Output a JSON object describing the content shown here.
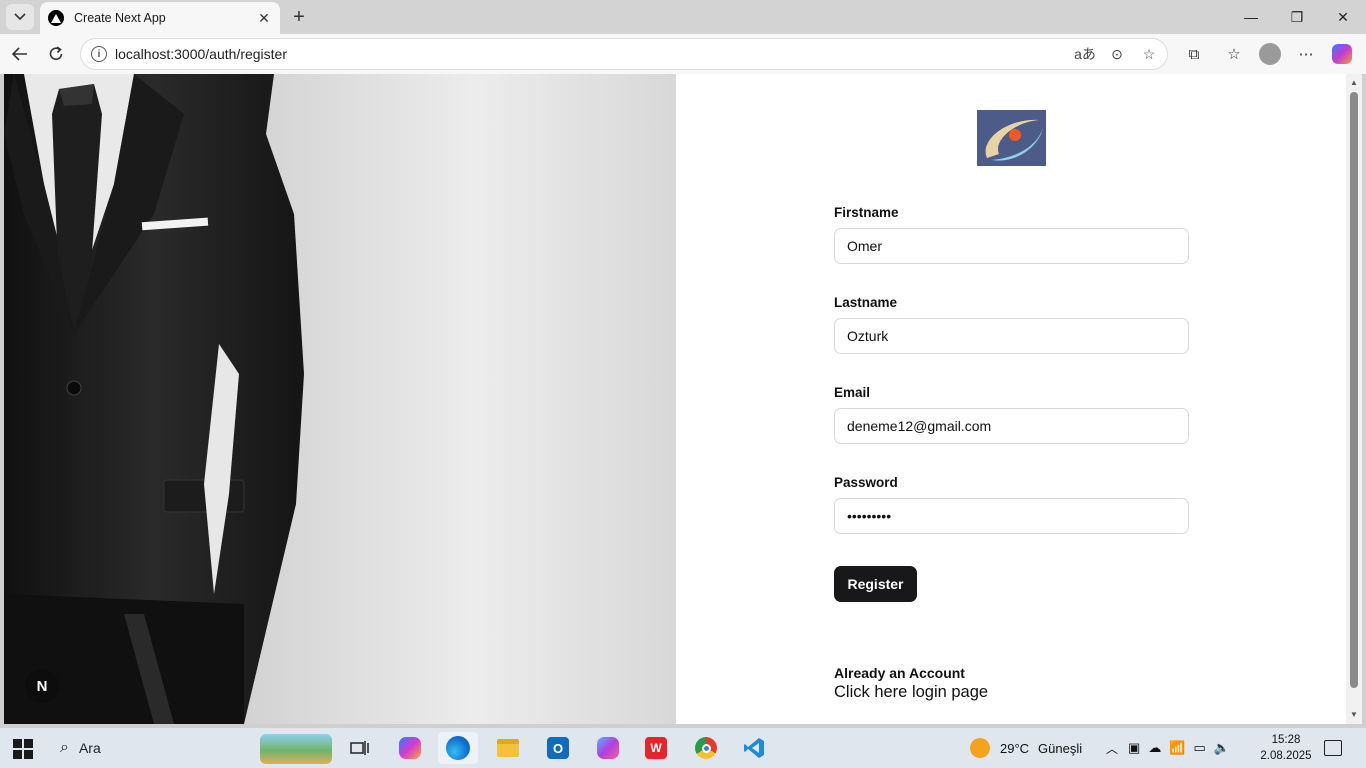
{
  "browser": {
    "tab_title": "Create Next App",
    "url": "localhost:3000/auth/register"
  },
  "form": {
    "fields": [
      {
        "label": "Firstname",
        "value": "Omer"
      },
      {
        "label": "Lastname",
        "value": "Ozturk"
      },
      {
        "label": "Email",
        "value": "deneme12@gmail.com"
      },
      {
        "label": "Password",
        "value": "•••••••••"
      }
    ],
    "register_label": "Register",
    "already_account": "Already an Account",
    "login_link": "Click here login page"
  },
  "dev_badge": "N",
  "taskbar": {
    "search_label": "Ara",
    "weather_temp": "29°C",
    "weather_desc": "Güneşli",
    "time": "15:28",
    "date": "2.08.2025"
  },
  "colors": {
    "button_bg": "#18181b",
    "page_bg": "#ffffff",
    "taskbar_bg": "#dfe6ee"
  }
}
